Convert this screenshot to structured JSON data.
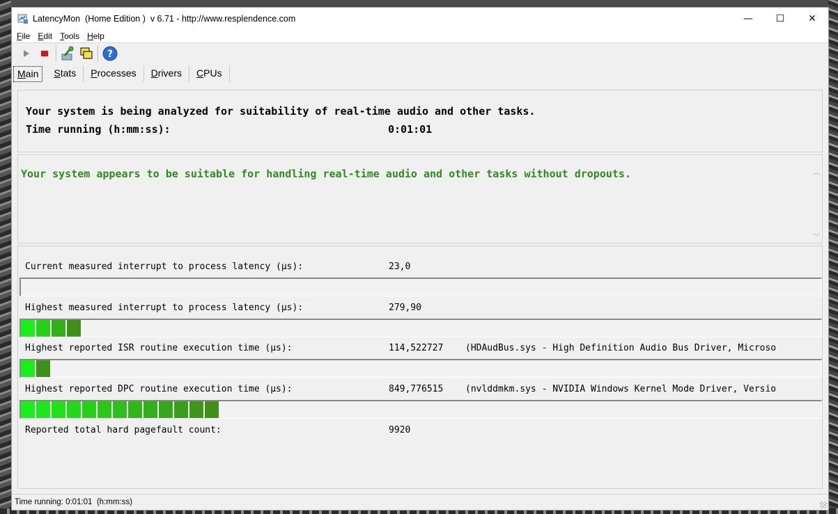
{
  "window": {
    "title": "LatencyMon  (Home Edition )  v 6.71 - http://www.resplendence.com",
    "minimize_glyph": "—",
    "maximize_glyph": "☐",
    "close_glyph": "✕"
  },
  "menu": [
    {
      "label": "File",
      "accel": "F",
      "rest": "ile"
    },
    {
      "label": "Edit",
      "accel": "E",
      "rest": "dit"
    },
    {
      "label": "Tools",
      "accel": "T",
      "rest": "ools"
    },
    {
      "label": "Help",
      "accel": "H",
      "rest": "elp"
    }
  ],
  "toolbar": {
    "icons": [
      "play-icon",
      "stop-icon",
      "driver-tool-icon",
      "windows-icon",
      "help-icon"
    ]
  },
  "tabs": [
    {
      "label": "Main",
      "accel": "M",
      "rest": "ain",
      "active": true
    },
    {
      "label": "Stats",
      "accel": "S",
      "rest": "tats"
    },
    {
      "label": "Processes",
      "accel": "P",
      "rest": "rocesses"
    },
    {
      "label": "Drivers",
      "accel": "D",
      "rest": "rivers"
    },
    {
      "label": "CPUs",
      "accel": "C",
      "rest": "PUs"
    }
  ],
  "analysis": {
    "line1": "Your system is being analyzed for suitability of real-time audio and other tasks.",
    "time_label": "Time running (h:mm:ss):",
    "time_value": "0:01:01"
  },
  "verdict": {
    "text": "Your system appears to be suitable for handling real-time audio and other tasks without dropouts.",
    "color": "#2e8b1e"
  },
  "metrics": {
    "current_label": "Current measured interrupt to process latency (µs):",
    "current_value": "23,0",
    "current_bar_segments": 0,
    "highest_label": "Highest measured interrupt to process latency (µs):",
    "highest_value": "279,90",
    "highest_bar_segments": 4,
    "isr_label": "Highest reported ISR routine execution time (µs):",
    "isr_value": "114,522727",
    "isr_detail": "(HDAudBus.sys - High Definition Audio Bus Driver, Microso",
    "isr_bar_segments": 2,
    "dpc_label": "Highest reported DPC routine execution time (µs):",
    "dpc_value": "849,776515",
    "dpc_detail": "(nvlddmkm.sys - NVIDIA Windows Kernel Mode Driver, Versio",
    "dpc_bar_segments": 13,
    "pagefault_label": "Reported total hard pagefault count:",
    "pagefault_value": "9920"
  },
  "bar_colors": {
    "bright": "#19f019",
    "dark": "#3f8f1a"
  },
  "statusbar": {
    "text": "Time running: 0:01:01  (h:mm:ss)"
  }
}
